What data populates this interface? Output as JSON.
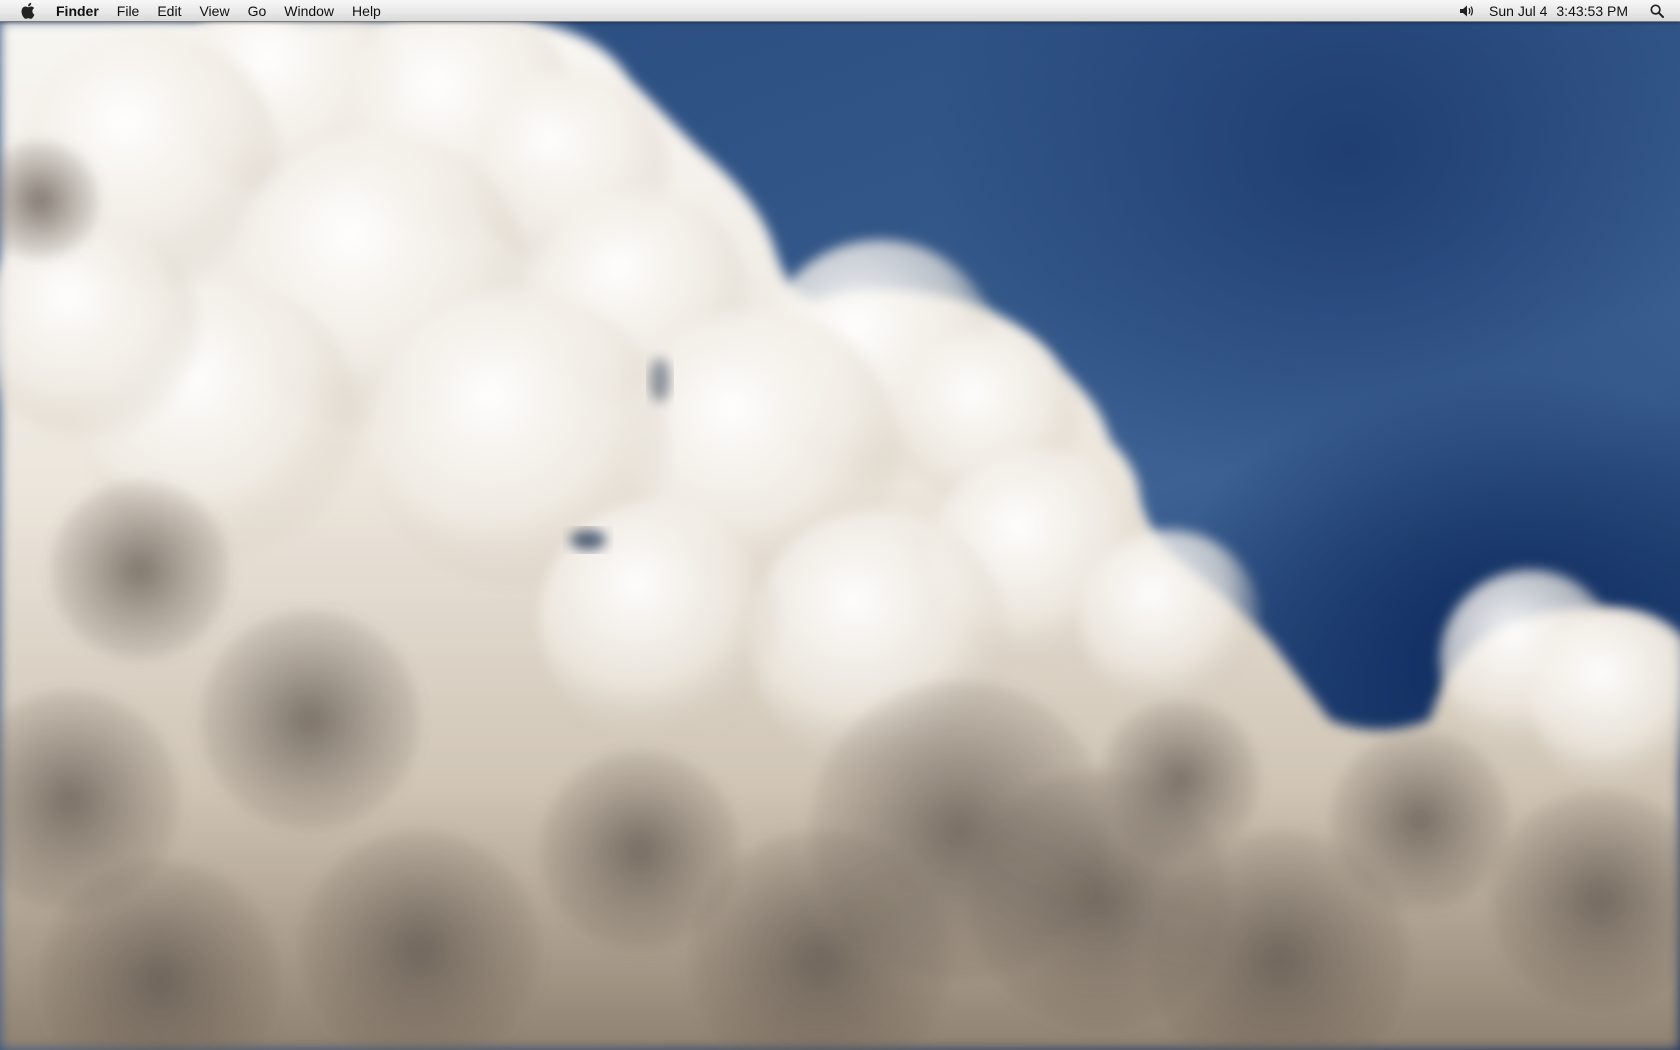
{
  "menubar": {
    "apple_icon": "apple-logo-icon",
    "app_name": "Finder",
    "menus": [
      "File",
      "Edit",
      "View",
      "Go",
      "Window",
      "Help"
    ],
    "status": {
      "volume_icon": "speaker-volume-icon",
      "date": "Sun Jul 4",
      "time": "3:43:53 PM",
      "spotlight_icon": "magnifying-glass-icon"
    }
  },
  "desktop": {
    "wallpaper_colors": {
      "sky": "#2a4b7f",
      "sky_deep": "#0f2a5a",
      "cloud_highlight": "#f6f3ee",
      "cloud_mid": "#d9d2c8",
      "cloud_shadow": "#6b625a"
    }
  }
}
